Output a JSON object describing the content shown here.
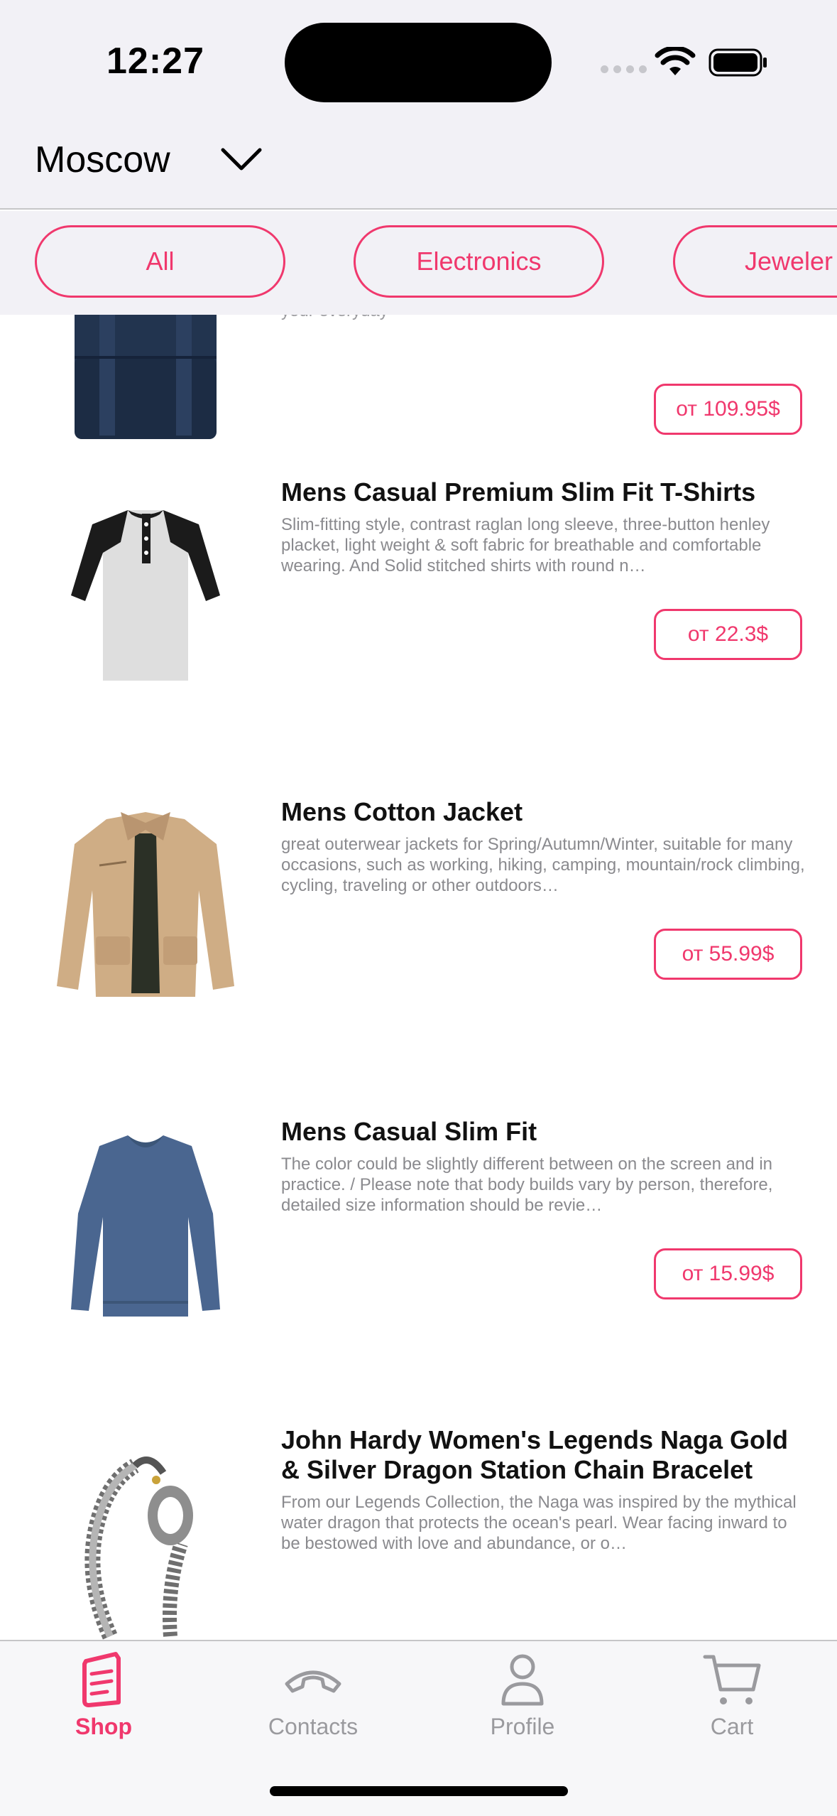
{
  "status": {
    "time": "12:27"
  },
  "header": {
    "city": "Moscow"
  },
  "categories": [
    {
      "label": "All"
    },
    {
      "label": "Electronics"
    },
    {
      "label": "Jeweler"
    }
  ],
  "products": [
    {
      "title": "",
      "description": "your everyday",
      "price": "от 109.95$",
      "image": "backpack"
    },
    {
      "title": "Mens Casual Premium Slim Fit T-Shirts",
      "description": "Slim-fitting style, contrast raglan long sleeve, three-button henley placket, light weight & soft fabric for breathable and comfortable wearing. And Solid stitched shirts with round n…",
      "price": "от 22.3$",
      "image": "raglan-shirt"
    },
    {
      "title": "Mens Cotton Jacket",
      "description": "great outerwear jackets for Spring/Autumn/Winter, suitable for many occasions, such as working, hiking, camping, mountain/rock climbing, cycling, traveling or other outdoors…",
      "price": "от 55.99$",
      "image": "cotton-jacket"
    },
    {
      "title": "Mens Casual Slim Fit",
      "description": "The color could be slightly different between on the screen and in practice. / Please note that body builds vary by person, therefore, detailed size information should be revie…",
      "price": "от 15.99$",
      "image": "blue-longsleeve"
    },
    {
      "title": "John Hardy Women's Legends Naga Gold & Silver Dragon Station Chain Bracelet",
      "description": "From our Legends Collection, the Naga was inspired by the mythical water dragon that protects the ocean's pearl. Wear facing inward to be bestowed with love and abundance, or o…",
      "price": "",
      "image": "dragon-bracelet"
    }
  ],
  "tabs": [
    {
      "label": "Shop",
      "icon": "book-icon",
      "active": true
    },
    {
      "label": "Contacts",
      "icon": "phone-icon",
      "active": false
    },
    {
      "label": "Profile",
      "icon": "person-icon",
      "active": false
    },
    {
      "label": "Cart",
      "icon": "cart-icon",
      "active": false
    }
  ],
  "colors": {
    "accent": "#f0386d",
    "header_bg": "#f2f1f6",
    "inactive": "#9a9a9e"
  }
}
